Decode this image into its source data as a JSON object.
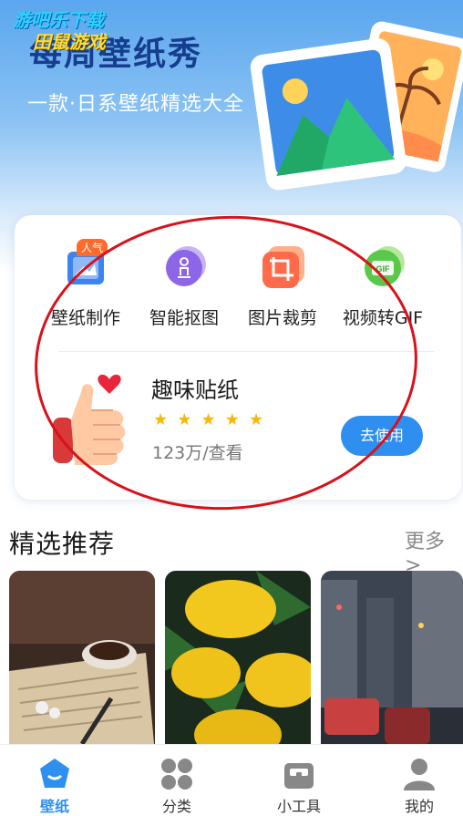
{
  "watermark": {
    "line1": "游吧乐下载",
    "line2": "田鼠游戏"
  },
  "hero": {
    "title": "每周壁纸秀",
    "subtitle": "一款·日系壁纸精选大全"
  },
  "tools": [
    {
      "label": "壁纸制作",
      "badge": "人气",
      "icon": "photo-frame-icon"
    },
    {
      "label": "智能抠图",
      "icon": "person-cutout-icon"
    },
    {
      "label": "图片裁剪",
      "icon": "crop-icon"
    },
    {
      "label": "视频转GIF",
      "icon": "gif-icon"
    }
  ],
  "sticker": {
    "title": "趣味贴纸",
    "rating": 5,
    "views": "123万/查看",
    "button": "去使用"
  },
  "featured": {
    "title": "精选推荐",
    "more": "更多 >"
  },
  "tabs": [
    {
      "label": "壁纸",
      "icon": "wallpaper-icon",
      "active": true
    },
    {
      "label": "分类",
      "icon": "category-icon"
    },
    {
      "label": "小工具",
      "icon": "toolbox-icon"
    },
    {
      "label": "我的",
      "icon": "profile-icon"
    }
  ],
  "colors": {
    "accent": "#2e8ff0",
    "title": "#163d8e",
    "annotation": "#d9111a",
    "star": "#f6b800"
  }
}
